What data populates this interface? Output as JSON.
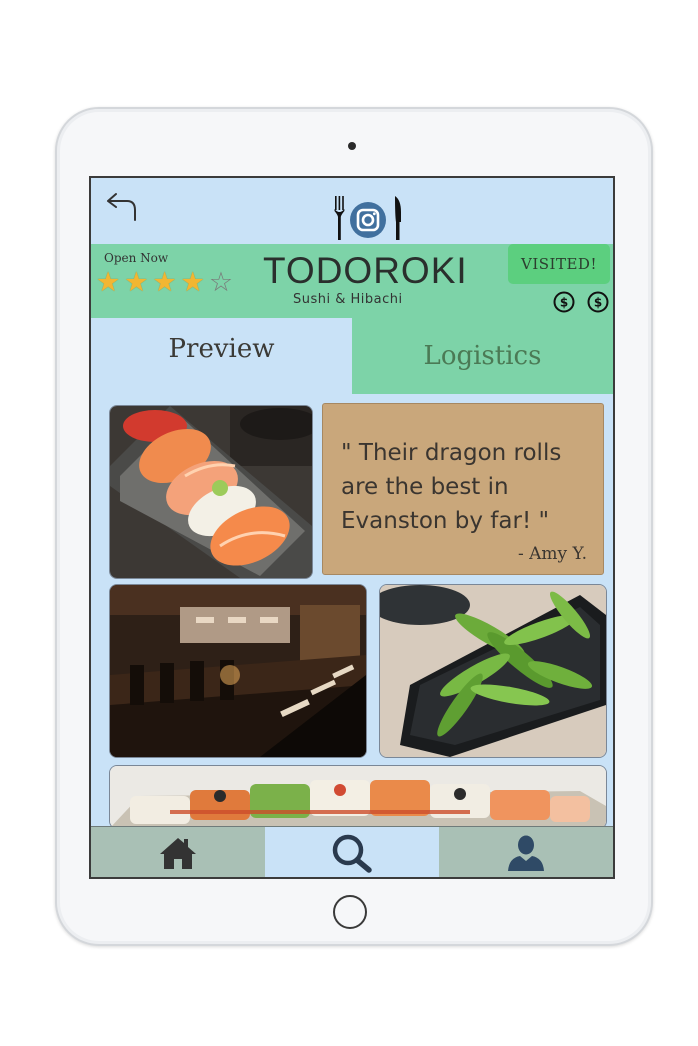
{
  "header": {
    "open_status": "Open Now",
    "rating": 4,
    "rating_max": 5,
    "restaurant_name": "TODOROKI",
    "cuisine": "Sushi & Hibachi",
    "visited_label": "VISITED!",
    "price_level": 2
  },
  "tabs": [
    {
      "label": "Preview",
      "active": true
    },
    {
      "label": "Logistics",
      "active": false
    }
  ],
  "review": {
    "quote": "\" Their dragon rolls are the best in Evanston by far! \"",
    "author": "- Amy Y."
  },
  "nav": {
    "items": [
      "home-icon",
      "search-icon",
      "user-icon"
    ],
    "active": "search"
  },
  "colors": {
    "screen_bg": "#c9e2f7",
    "header_green": "#7dd3a8",
    "visited_green": "#5ccf7f",
    "quote_bg": "#c9a77b",
    "nav_inactive": "#a9c0b5",
    "star_gold": "#f2b632"
  }
}
